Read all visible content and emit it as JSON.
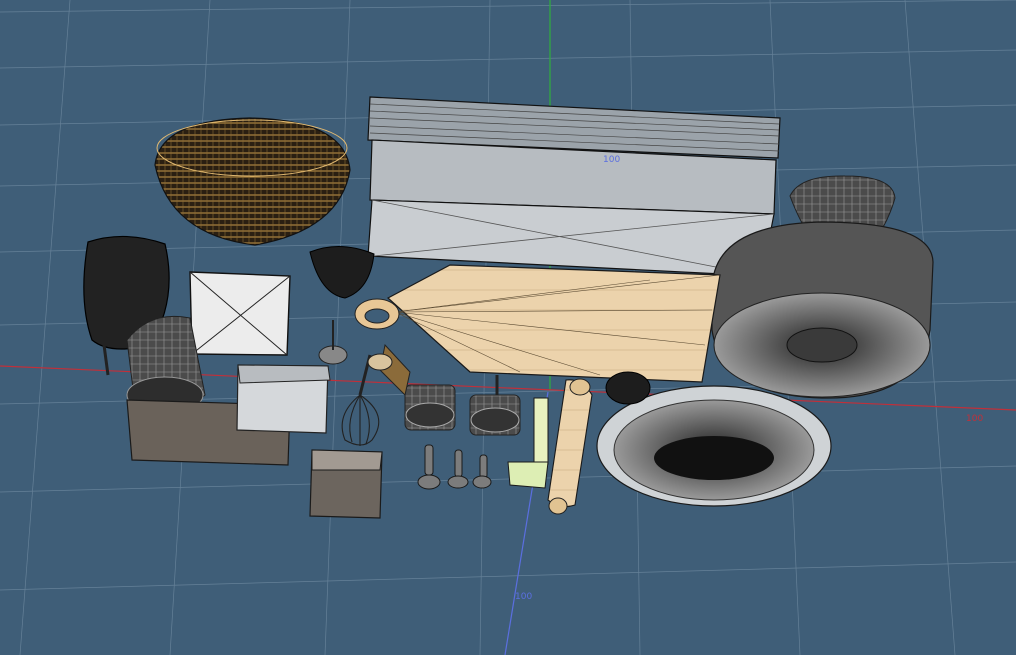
{
  "viewport": {
    "background": "#3f5e78",
    "grid_color": "#6f8aa0",
    "axis_colors": {
      "x": "#c0303a",
      "y": "#2fae3e",
      "z": "#5b6fe0"
    }
  },
  "axis_labels": {
    "y_marker": "100",
    "x_marker": "100",
    "z_marker": "100"
  },
  "objects": [
    "wicker-basket",
    "baking-tray-stack",
    "fluted-bowl",
    "bundt-pan",
    "black-mixing-bowl",
    "muffin-cup",
    "square-dish",
    "measuring-cup",
    "kitchen-scale",
    "flour-sifter",
    "whisk",
    "cutting-board",
    "rolling-pin",
    "spatula",
    "pie-dish",
    "small-pot",
    "scoop",
    "measuring-spoons",
    "storage-box",
    "cookie-cutter",
    "dough-scraper"
  ]
}
